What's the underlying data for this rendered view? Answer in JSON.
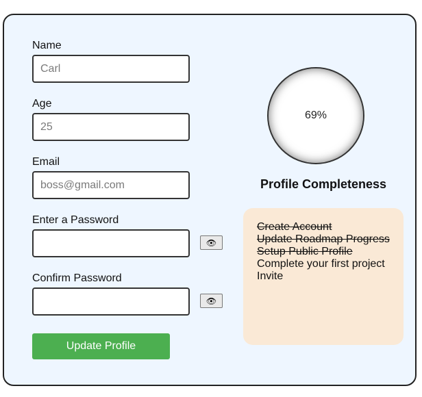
{
  "form": {
    "name": {
      "label": "Name",
      "value": "",
      "placeholder": "Carl"
    },
    "age": {
      "label": "Age",
      "value": "",
      "placeholder": "25"
    },
    "email": {
      "label": "Email",
      "value": "",
      "placeholder": "boss@gmail.com"
    },
    "password": {
      "label": "Enter a Password",
      "value": "",
      "placeholder": "",
      "toggle_icon": "eye-icon",
      "toggle_glyph": "👁"
    },
    "confirm_password": {
      "label": "Confirm Password",
      "value": "",
      "placeholder": "",
      "toggle_icon": "eye-icon",
      "toggle_glyph": "👁"
    },
    "submit_label": "Update Profile"
  },
  "profile": {
    "completeness_percent": 69,
    "completeness_text": "69%",
    "title": "Profile Completeness",
    "tasks": [
      {
        "label": "Create Account",
        "done": true
      },
      {
        "label": "Update Roadmap Progress",
        "done": true
      },
      {
        "label": "Setup Public Profile",
        "done": true
      },
      {
        "label": "Complete your first project",
        "done": false
      },
      {
        "label": "Invite",
        "done": false
      }
    ]
  },
  "colors": {
    "card_background": "#eef6ff",
    "accent_button": "#4caf50",
    "tasks_background": "#fae9d6"
  }
}
